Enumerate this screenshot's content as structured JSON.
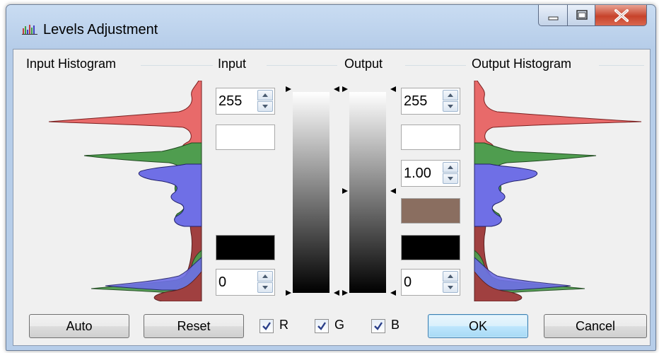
{
  "window": {
    "title": "Levels Adjustment",
    "icons": {
      "app": "histogram-icon",
      "minimize": "minimize-icon",
      "maximize": "maximize-icon",
      "close": "close-icon"
    }
  },
  "groups": {
    "input_histogram": "Input Histogram",
    "input": "Input",
    "output": "Output",
    "output_histogram": "Output Histogram"
  },
  "input": {
    "high": "255",
    "low": "0",
    "high_color": "#ffffff",
    "low_color": "#000000"
  },
  "output": {
    "high": "255",
    "gamma": "1.00",
    "low": "0",
    "high_color": "#ffffff",
    "gamma_color": "#8a6e60",
    "low_color": "#000000"
  },
  "buttons": {
    "auto": "Auto",
    "reset": "Reset",
    "ok": "OK",
    "cancel": "Cancel"
  },
  "channels": [
    {
      "label": "R",
      "checked": true
    },
    {
      "label": "G",
      "checked": true
    },
    {
      "label": "B",
      "checked": true
    }
  ],
  "colors": {
    "red": "#e86a6a",
    "green": "#4f9d4f",
    "blue": "#6f6fe6",
    "combined": "#a04040"
  }
}
